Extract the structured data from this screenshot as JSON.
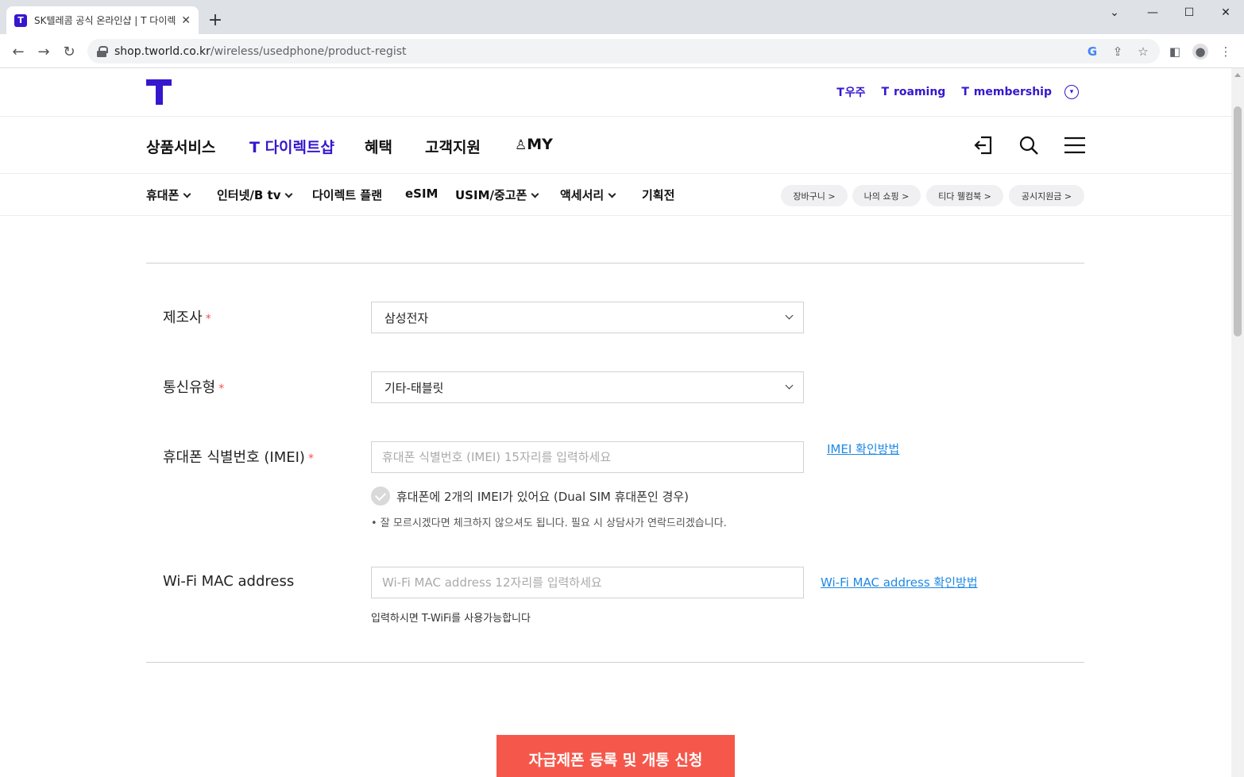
{
  "browser": {
    "tab_title": "SK텔레콤 공식 온라인샵 | T 다이렉트샵",
    "url_host": "shop.tworld.co.kr",
    "url_path": "/wireless/usedphone/product-regist"
  },
  "header": {
    "top_links": [
      {
        "prefix": "T",
        "label": "우주"
      },
      {
        "prefix": "T",
        "label": "roaming"
      },
      {
        "prefix": "T",
        "label": "membership"
      }
    ]
  },
  "gnb": {
    "items": [
      "상품서비스",
      "T 다이렉트샵",
      "혜택",
      "고객지원",
      "MY"
    ],
    "active_index": 1
  },
  "lnb": {
    "items": [
      "휴대폰",
      "인터넷/B tv",
      "다이렉트 플랜",
      "eSIM",
      "USIM/중고폰",
      "액세서리",
      "기획전"
    ],
    "pills": [
      "장바구니 >",
      "나의 쇼핑 >",
      "티다 웰컴북 >",
      "공시지원금 >"
    ]
  },
  "form": {
    "manufacturer": {
      "label": "제조사",
      "value": "삼성전자"
    },
    "carrier_type": {
      "label": "통신유형",
      "value": "기타-태블릿"
    },
    "imei": {
      "label": "휴대폰 식별번호 (IMEI)",
      "placeholder": "휴대폰 식별번호 (IMEI) 15자리를 입력하세요",
      "help_link": "IMEI 확인방법",
      "dual_check_label": "휴대폰에 2개의 IMEI가 있어요 (Dual SIM 휴대폰인 경우)",
      "note": "• 잘 모르시겠다면 체크하지 않으셔도 됩니다. 필요 시 상담사가 연락드리겠습니다."
    },
    "wifi_mac": {
      "label": "Wi-Fi MAC address",
      "placeholder": "Wi-Fi MAC address 12자리를 입력하세요",
      "help_link": "Wi-Fi MAC address 확인방법",
      "note": "입력하시면 T-WiFi를 사용가능합니다"
    },
    "required_mark": "*",
    "submit_label": "자급제폰 등록 및 개통 신청"
  },
  "colors": {
    "brand": "#3617ce",
    "submit": "#f5584b",
    "link": "#1e88e5"
  }
}
